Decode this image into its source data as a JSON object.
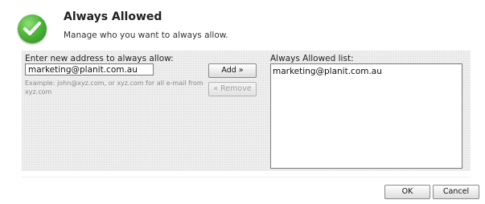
{
  "header": {
    "title": "Always Allowed",
    "subtitle": "Manage who you want to always allow.",
    "icon": "checkmark-icon"
  },
  "left": {
    "label": "Enter new address to always allow:",
    "input_value": "marketing@planit.com.au",
    "example": "Example: john@xyz.com, or xyz.com for all e-mail from xyz.com"
  },
  "buttons": {
    "add": "Add »",
    "remove": "« Remove",
    "ok": "OK",
    "cancel": "Cancel"
  },
  "right": {
    "label": "Always Allowed list:",
    "items": [
      "marketing@planit.com.au"
    ]
  }
}
